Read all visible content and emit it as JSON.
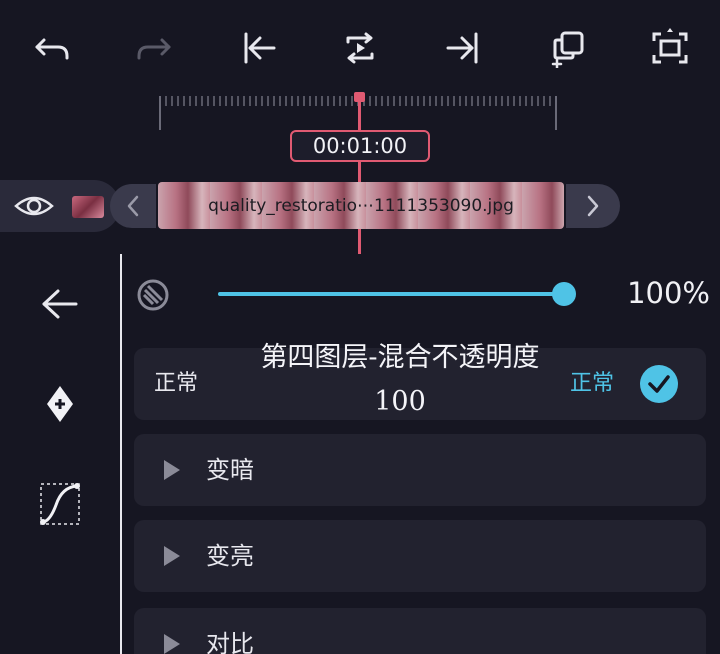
{
  "timeline": {
    "timecode": "00:01:00",
    "clip_name": "quality_restoratio⋯1111353090.jpg"
  },
  "toolbar": {
    "icons": [
      "undo-icon",
      "redo-icon",
      "jump-to-start-icon",
      "loop-play-icon",
      "jump-to-end-icon",
      "add-copy-icon",
      "fullscreen-icon"
    ]
  },
  "opacity": {
    "value_label": "100%",
    "level": 1.0
  },
  "overlay": {
    "title": "第四图层-混合不透明度",
    "value": "100"
  },
  "blend": {
    "normal_label": "正常",
    "normal_selected": "正常",
    "groups": [
      {
        "label": "变暗"
      },
      {
        "label": "变亮"
      },
      {
        "label": "对比"
      }
    ]
  },
  "colors": {
    "accent": "#4fc3e6",
    "playhead": "#e05a72",
    "background": "#161622",
    "row": "#22222f"
  }
}
